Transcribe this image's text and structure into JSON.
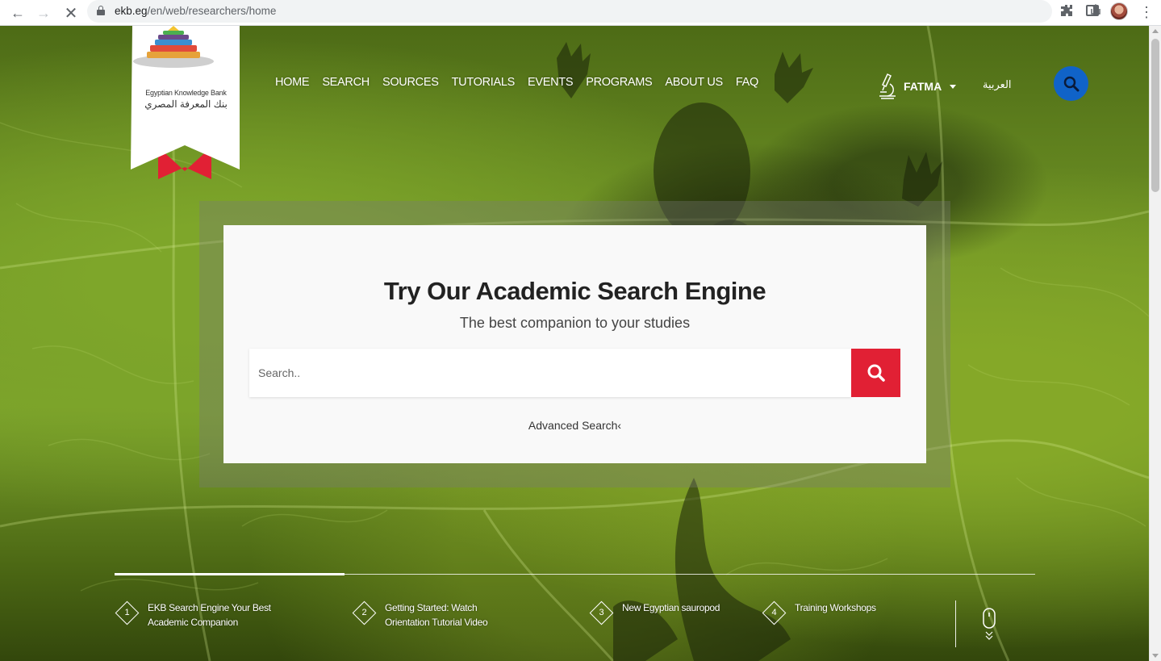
{
  "browser": {
    "url_host": "ekb.eg",
    "url_path": "/en/web/researchers/home"
  },
  "logo": {
    "name_en": "Egyptian Knowledge Bank",
    "name_ar": "بنك المعرفة المصري"
  },
  "nav": {
    "items": [
      "HOME",
      "SEARCH",
      "SOURCES",
      "TUTORIALS",
      "EVENTS",
      "PROGRAMS",
      "ABOUT US",
      "FAQ"
    ]
  },
  "user": {
    "name": "FATMA"
  },
  "language_link": "العربية",
  "search": {
    "title": "Try Our Academic Search Engine",
    "subtitle": "The best companion to your studies",
    "placeholder": "Search..",
    "advanced_label": "Advanced Search‹"
  },
  "slides": [
    {
      "number": "1",
      "label": "EKB Search Engine Your Best Academic Companion"
    },
    {
      "number": "2",
      "label": "Getting Started: Watch Orientation Tutorial Video"
    },
    {
      "number": "3",
      "label": "New Egyptian sauropod"
    },
    {
      "number": "4",
      "label": "Training Workshops"
    }
  ],
  "slider_progress": 0.25,
  "colors": {
    "search_button": "#e12034",
    "top_search_button": "#1063c8",
    "logo_ribbon": "#e12034"
  }
}
